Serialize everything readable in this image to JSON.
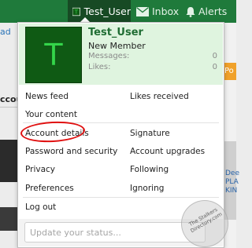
{
  "nav": {
    "user_label": "Test_User",
    "inbox_label": "Inbox",
    "alerts_label": "Alerts"
  },
  "background": {
    "ad_text": "ad",
    "section_text": "ccou",
    "right_tab_text": "Po",
    "right_links": [
      "Dee",
      "PLA",
      "KIN"
    ]
  },
  "profile": {
    "avatar_letter": "T",
    "username": "Test_User",
    "member_title": "New Member",
    "stats": [
      {
        "label": "Messages:",
        "value": "0"
      },
      {
        "label": "Likes:",
        "value": "0"
      }
    ]
  },
  "menu": {
    "news_feed": "News feed",
    "likes_received": "Likes received",
    "your_content": "Your content",
    "account_details": "Account details",
    "signature": "Signature",
    "password_security": "Password and security",
    "account_upgrades": "Account upgrades",
    "privacy": "Privacy",
    "following": "Following",
    "preferences": "Preferences",
    "ignoring": "Ignoring",
    "log_out": "Log out"
  },
  "status": {
    "placeholder": "Update your status..."
  },
  "watermark": {
    "text": "The Stalkers Directory.com"
  },
  "colors": {
    "navbar": "#1f7a3b",
    "profile_bg": "#dff4df",
    "username": "#1f6d33",
    "highlight_circle": "#e01010"
  }
}
